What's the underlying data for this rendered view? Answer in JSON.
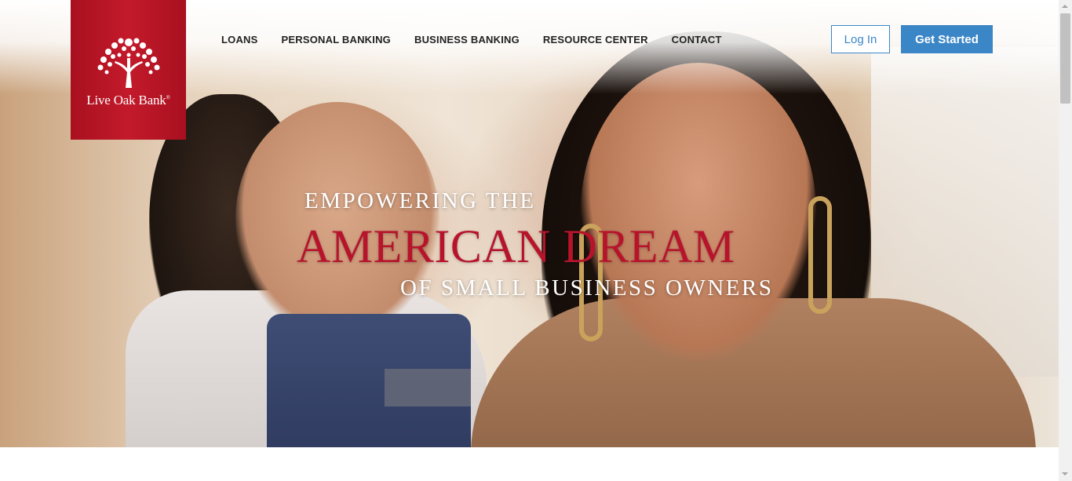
{
  "brand": {
    "name": "Live Oak Bank",
    "trademark": "®",
    "logo_icon": "oak-tree-icon",
    "colors": {
      "banner": "#b3121f",
      "accent": "#3b86c6",
      "headline_red": "#b7142c"
    }
  },
  "nav": {
    "items": [
      {
        "label": "LOANS"
      },
      {
        "label": "PERSONAL BANKING"
      },
      {
        "label": "BUSINESS BANKING"
      },
      {
        "label": "RESOURCE CENTER"
      },
      {
        "label": "CONTACT"
      }
    ]
  },
  "header": {
    "login_label": "Log In",
    "get_started_label": "Get Started"
  },
  "hero": {
    "line1": "Empowering the",
    "line2": "American Dream",
    "line3": "of Small Business Owners"
  }
}
